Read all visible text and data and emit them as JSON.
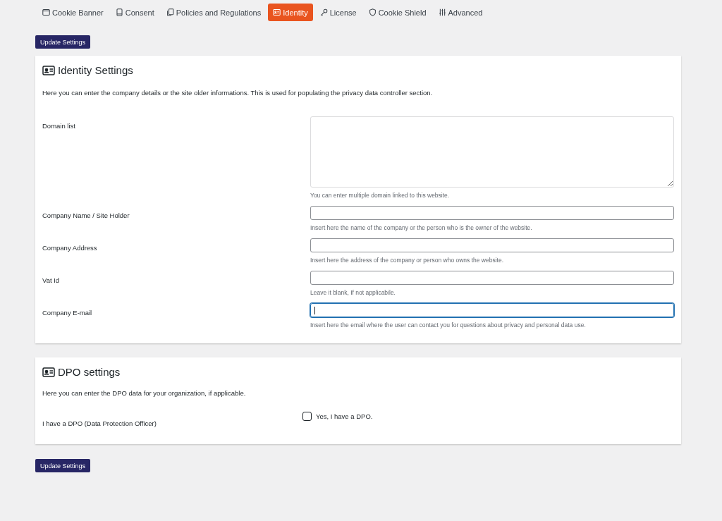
{
  "tabs": [
    {
      "label": "Cookie Banner",
      "selected": false
    },
    {
      "label": "Consent",
      "selected": false
    },
    {
      "label": "Policies and Regulations",
      "selected": false
    },
    {
      "label": "Identity",
      "selected": true
    },
    {
      "label": "License",
      "selected": false
    },
    {
      "label": "Cookie Shield",
      "selected": false
    },
    {
      "label": "Advanced",
      "selected": false
    }
  ],
  "update_button_top": "Update Settings",
  "identity": {
    "title": "Identity Settings",
    "description": "Here you can enter the company details or the site older informations. This is used for populating the privacy data controller section.",
    "fields": [
      {
        "kind": "textarea",
        "label": "Domain list",
        "help": "You can enter multiple domain linked to this website.",
        "focused": false
      },
      {
        "kind": "input",
        "label": "Company Name / Site Holder",
        "help": "Insert here the name of the company or the person who is the owner of the website.",
        "focused": false
      },
      {
        "kind": "input",
        "label": "Company Address",
        "help": "Insert here the address of the company or person who owns the website.",
        "focused": false
      },
      {
        "kind": "input",
        "label": "Vat Id",
        "help": "Leave it blank, If not applicabile.",
        "focused": false
      },
      {
        "kind": "input",
        "label": "Company E-mail",
        "help": "Insert here the email where the user can contact you for questions about privacy and personal data use.",
        "focused": true
      }
    ]
  },
  "dpo": {
    "title": "DPO settings",
    "description": "Here you can enter the DPO data for your organization, if applicable.",
    "label": "I have a DPO (Data Protection Officer)",
    "checkbox": {
      "label": "Yes, I have a DPO.",
      "checked": false
    }
  },
  "update_button_bottom": "Update Settings"
}
